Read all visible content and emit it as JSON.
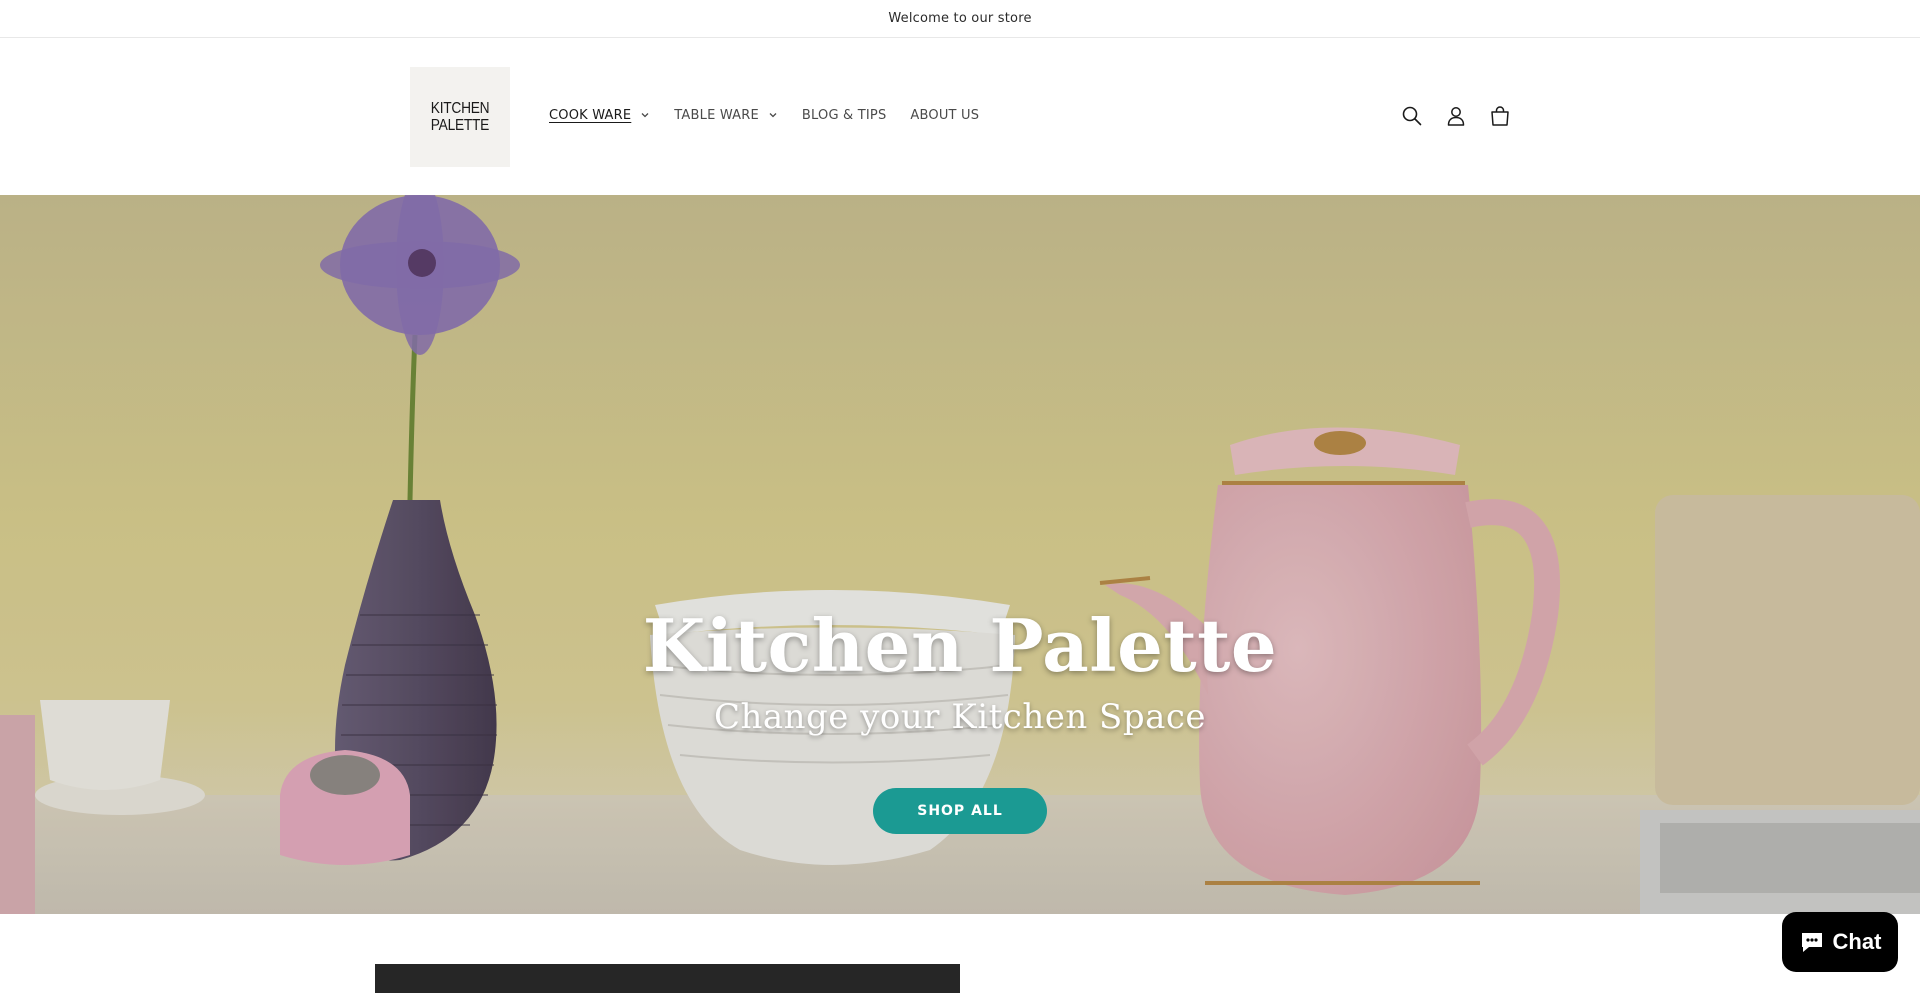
{
  "announcement": {
    "text": "Welcome to our store"
  },
  "header": {
    "logo": {
      "line1": "KITCHEN",
      "line2": "PALETTE"
    },
    "nav": [
      {
        "label": "COOK WARE",
        "has_dropdown": true,
        "active": true
      },
      {
        "label": "TABLE WARE",
        "has_dropdown": true,
        "active": false
      },
      {
        "label": "BLOG & TIPS",
        "has_dropdown": false,
        "active": false
      },
      {
        "label": "ABOUT US",
        "has_dropdown": false,
        "active": false
      }
    ],
    "icons": [
      "search-icon",
      "account-icon",
      "cart-icon"
    ]
  },
  "hero": {
    "title": "Kitchen Palette",
    "subtitle": "Change your Kitchen Space",
    "button_label": "SHOP ALL",
    "button_color": "#1b9a93"
  },
  "chat": {
    "label": "Chat",
    "icon": "chat-bubble-icon"
  }
}
